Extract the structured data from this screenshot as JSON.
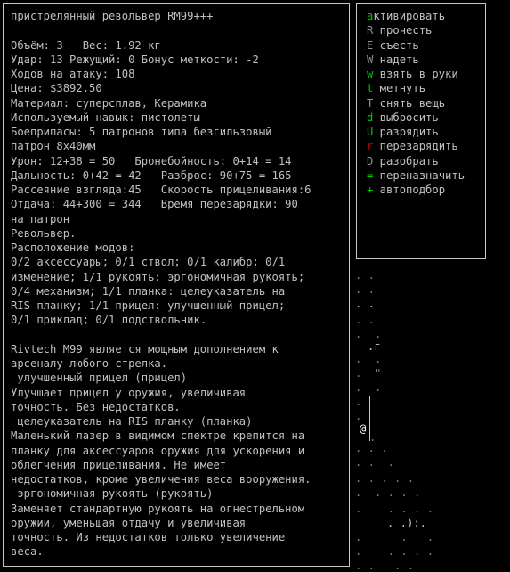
{
  "info": {
    "lines": [
      "пристрелянный револьвер RM99+++",
      "",
      "Объём: 3   Вес: 1.92 кг",
      "Удар: 13 Режущий: 0 Бонус меткости: -2",
      "Ходов на атаку: 108",
      "Цена: $3892.50",
      "Материал: суперсплав, Керамика",
      "Используемый навык: пистолеты",
      "Боеприпасы: 5 патронов типа безгильзовый",
      "патрон 8x40мм",
      "Урон: 12+38 = 50   Бронебойность: 0+14 = 14",
      "Дальность: 0+42 = 42   Разброс: 90+75 = 165",
      "Рассеяние взгляда:45   Скорость прицеливания:6",
      "Отдача: 44+300 = 344   Время перезарядки: 90",
      "на патрон",
      "Револьвер.",
      "Расположение модов:",
      "0/2 аксессуары; 0/1 ствол; 0/1 калибр; 0/1",
      "изменение; 1/1 рукоять: эргономичная рукоять;",
      "0/4 механизм; 1/1 планка: целеуказатель на",
      "RIS планку; 1/1 прицел: улучшенный прицел;",
      "0/1 приклад; 0/1 подствольник.",
      "",
      "Rivtech M99 является мощным дополнением к",
      "арсеналу любого стрелка.",
      " улучшенный прицел (прицел)",
      "Улучшает прицел у оружия, увеличивая",
      "точность. Без недостатков.",
      " целеуказатель на RIS планку (планка)",
      "Маленький лазер в видимом спектре крепится на",
      "планку для аксессуаров оружия для ускорения и",
      "облегчения прицеливания. Не имеет",
      "недостатков, кроме увеличения веса вооружения.",
      " эргономичная рукоять (рукоять)",
      "Заменяет стандартную рукоять на огнестрельном",
      "оружии, уменьшая отдачу и увеличивая",
      "точность. Из недостатков только увеличение",
      "веса."
    ]
  },
  "menu": {
    "items": [
      {
        "key": "a",
        "label": "ктивировать",
        "key_color": "#00c800"
      },
      {
        "key": "R",
        "label": " прочесть",
        "key_color": "#909090"
      },
      {
        "key": "E",
        "label": " съесть",
        "key_color": "#909090"
      },
      {
        "key": "W",
        "label": " надеть",
        "key_color": "#909090"
      },
      {
        "key": "w",
        "label": " взять в руки",
        "key_color": "#00c800"
      },
      {
        "key": "t",
        "label": " метнуть",
        "key_color": "#00c800"
      },
      {
        "key": "T",
        "label": " снять вещь",
        "key_color": "#909090"
      },
      {
        "key": "d",
        "label": " выбросить",
        "key_color": "#00c800"
      },
      {
        "key": "U",
        "label": " разрядить",
        "key_color": "#00c800"
      },
      {
        "key": "r",
        "label": " перезарядить",
        "key_color": "#c80000"
      },
      {
        "key": "D",
        "label": " разобрать",
        "key_color": "#909090"
      },
      {
        "key": "=",
        "label": " переназначить",
        "key_color": "#00c800"
      },
      {
        "key": "+",
        "label": " автоподбор",
        "key_color": "#00c800"
      }
    ]
  },
  "map": {
    "player_glyph": "@"
  }
}
